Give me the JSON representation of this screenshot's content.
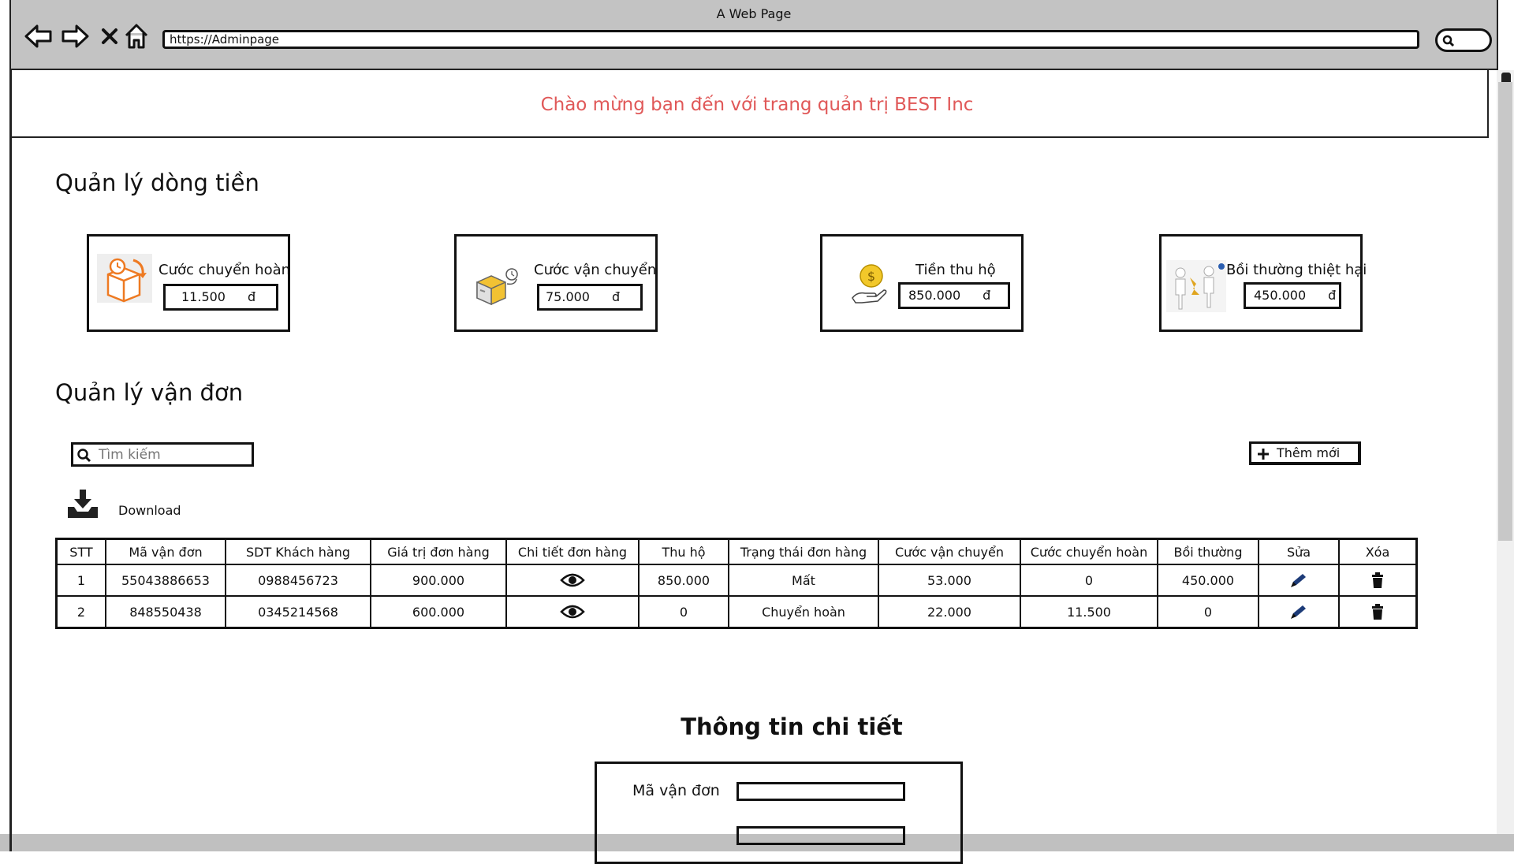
{
  "browser": {
    "title": "A Web Page",
    "url": "https://Adminpage"
  },
  "welcome": "Chào mừng bạn đến với trang quản trị BEST Inc",
  "cashflow": {
    "heading": "Quản lý dòng tiền",
    "cards": [
      {
        "label": "Cước chuyển hoàn",
        "value": "11.500",
        "currency": "đ",
        "icon": "return-box-icon"
      },
      {
        "label": "Cước vận chuyển",
        "value": "75.000",
        "currency": "đ",
        "icon": "shipping-box-icon"
      },
      {
        "label": "Tiền thu hộ",
        "value": "850.000",
        "currency": "đ",
        "icon": "coin-hand-icon"
      },
      {
        "label": "Bồi thường thiệt hại",
        "value": "450.000",
        "currency": "đ",
        "icon": "compensation-people-icon"
      }
    ]
  },
  "orders": {
    "heading": "Quản lý vận đơn",
    "search_placeholder": "Tìm kiếm",
    "add_label": "Thêm mới",
    "download_label": "Download",
    "columns": [
      "STT",
      "Mã vận đơn",
      "SDT Khách hàng",
      "Giá trị đơn hàng",
      "Chi tiết đơn hàng",
      "Thu hộ",
      "Trạng thái đơn hàng",
      "Cước vận chuyển",
      "Cước chuyển hoàn",
      "Bồi thường",
      "Sửa",
      "Xóa"
    ],
    "rows": [
      {
        "stt": "1",
        "code": "55043886653",
        "phone": "0988456723",
        "value": "900.000",
        "cod": "850.000",
        "status": "Mất",
        "ship_fee": "53.000",
        "return_fee": "0",
        "compensation": "450.000"
      },
      {
        "stt": "2",
        "code": "848550438",
        "phone": "0345214568",
        "value": "600.000",
        "cod": "0",
        "status": "Chuyển hoàn",
        "ship_fee": "22.000",
        "return_fee": "11.500",
        "compensation": "0"
      }
    ]
  },
  "detail": {
    "heading": "Thông tin chi tiết",
    "field_label": "Mã vận đơn"
  },
  "colors": {
    "welcome": "#e05858",
    "chrome": "#c3c3c3"
  }
}
